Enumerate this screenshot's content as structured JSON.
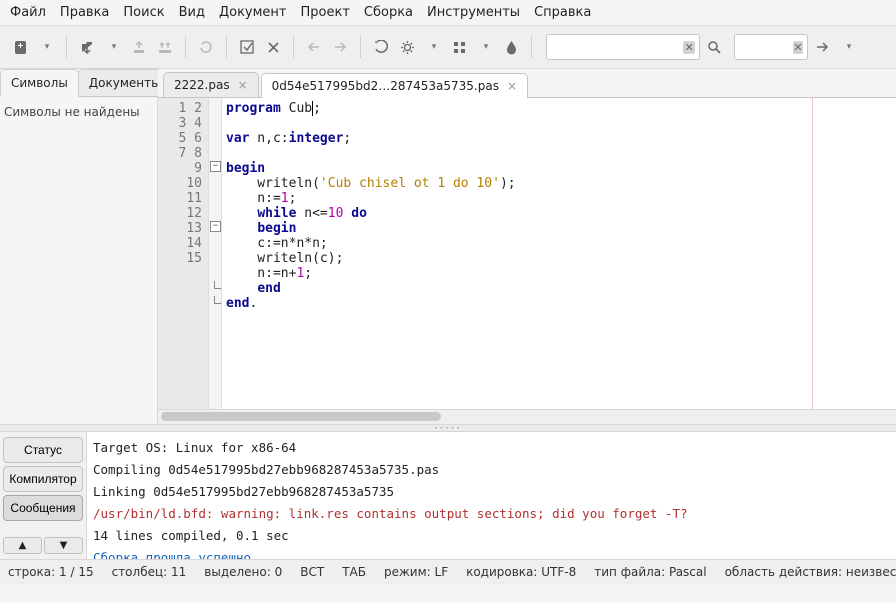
{
  "menu": [
    "Файл",
    "Правка",
    "Поиск",
    "Вид",
    "Документ",
    "Проект",
    "Сборка",
    "Инструменты",
    "Справка"
  ],
  "sidebar": {
    "tabs": [
      "Символы",
      "Документы"
    ],
    "active": 0,
    "empty": "Символы не найдены"
  },
  "editor": {
    "tabs": [
      {
        "label": "2222.pas",
        "active": false
      },
      {
        "label": "0d54e517995bd2…287453a5735.pas",
        "active": true
      }
    ]
  },
  "code": {
    "lines": [
      {
        "n": 1,
        "seg": [
          [
            "kw",
            "program"
          ],
          [
            "",
            " Cub"
          ],
          [
            "cursor",
            ""
          ],
          [
            "",
            ";"
          ]
        ]
      },
      {
        "n": 2,
        "seg": []
      },
      {
        "n": 3,
        "seg": [
          [
            "kw",
            "var"
          ],
          [
            "",
            " n,c:"
          ],
          [
            "ty",
            "integer"
          ],
          [
            "",
            ";"
          ]
        ]
      },
      {
        "n": 4,
        "seg": []
      },
      {
        "n": 5,
        "fold": "-",
        "seg": [
          [
            "kw",
            "begin"
          ]
        ]
      },
      {
        "n": 6,
        "seg": [
          [
            "",
            "    writeln("
          ],
          [
            "str",
            "'Cub chisel ot 1 do 10'"
          ],
          [
            "",
            ");"
          ]
        ]
      },
      {
        "n": 7,
        "seg": [
          [
            "",
            "    n:="
          ],
          [
            "num",
            "1"
          ],
          [
            "",
            ";"
          ]
        ]
      },
      {
        "n": 8,
        "seg": [
          [
            "",
            "    "
          ],
          [
            "kw",
            "while"
          ],
          [
            "",
            " n<="
          ],
          [
            "num",
            "10"
          ],
          [
            "",
            " "
          ],
          [
            "kw",
            "do"
          ]
        ]
      },
      {
        "n": 9,
        "fold": "-",
        "seg": [
          [
            "",
            "    "
          ],
          [
            "kw",
            "begin"
          ]
        ]
      },
      {
        "n": 10,
        "seg": [
          [
            "",
            "    c:=n*n*n;"
          ]
        ]
      },
      {
        "n": 11,
        "seg": [
          [
            "",
            "    writeln(c);"
          ]
        ]
      },
      {
        "n": 12,
        "seg": [
          [
            "",
            "    n:=n+"
          ],
          [
            "num",
            "1"
          ],
          [
            "",
            ";"
          ]
        ]
      },
      {
        "n": 13,
        "foldend": true,
        "seg": [
          [
            "",
            "    "
          ],
          [
            "kw",
            "end"
          ]
        ]
      },
      {
        "n": 14,
        "foldend": true,
        "seg": [
          [
            "kw",
            "end"
          ],
          [
            "",
            "."
          ]
        ]
      },
      {
        "n": 15,
        "seg": []
      }
    ]
  },
  "bottom_buttons": [
    "Статус",
    "Компилятор",
    "Сообщения"
  ],
  "bottom_active": 2,
  "console": [
    {
      "cls": "",
      "t": "Target OS: Linux for x86-64"
    },
    {
      "cls": "",
      "t": "Compiling 0d54e517995bd27ebb968287453a5735.pas"
    },
    {
      "cls": "",
      "t": "Linking 0d54e517995bd27ebb968287453a5735"
    },
    {
      "cls": "warn",
      "t": "/usr/bin/ld.bfd: warning: link.res contains output sections; did you forget -T?"
    },
    {
      "cls": "",
      "t": "14 lines compiled, 0.1 sec"
    },
    {
      "cls": "ok",
      "t": "Сборка прошла успешно."
    }
  ],
  "status": {
    "line": "строка: 1 / 15",
    "col": "столбец: 11",
    "sel": "выделено: 0",
    "ins": "ВСТ",
    "tab": "ТАБ",
    "mode": "режим: LF",
    "enc": "кодировка: UTF-8",
    "ft": "тип файла: Pascal",
    "scope": "область действия: неизвестно"
  }
}
